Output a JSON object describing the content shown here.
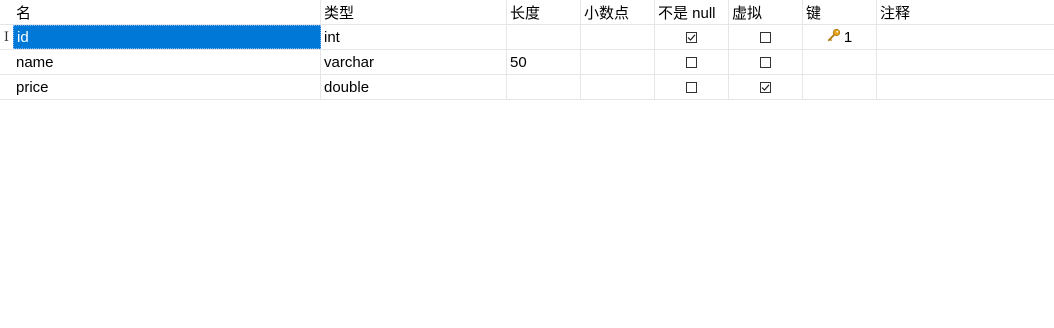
{
  "columns": {
    "name": "名",
    "type": "类型",
    "length": "长度",
    "decimals": "小数点",
    "not_null": "不是 null",
    "virtual": "虚拟",
    "key": "键",
    "comment": "注释"
  },
  "rows": [
    {
      "name": "id",
      "type": "int",
      "length": "",
      "decimals": "",
      "not_null": true,
      "virtual": false,
      "key": "1",
      "comment": "",
      "selected": true,
      "marker": "I"
    },
    {
      "name": "name",
      "type": "varchar",
      "length": "50",
      "decimals": "",
      "not_null": false,
      "virtual": false,
      "key": "",
      "comment": ""
    },
    {
      "name": "price",
      "type": "double",
      "length": "",
      "decimals": "",
      "not_null": false,
      "virtual": true,
      "key": "",
      "comment": ""
    }
  ],
  "icons": {
    "key": "key-icon",
    "checkbox": "checkbox-icon"
  },
  "colors": {
    "selection": "#0078d7",
    "grid_line": "#e6e6e6",
    "key_icon": "#e8a317"
  }
}
